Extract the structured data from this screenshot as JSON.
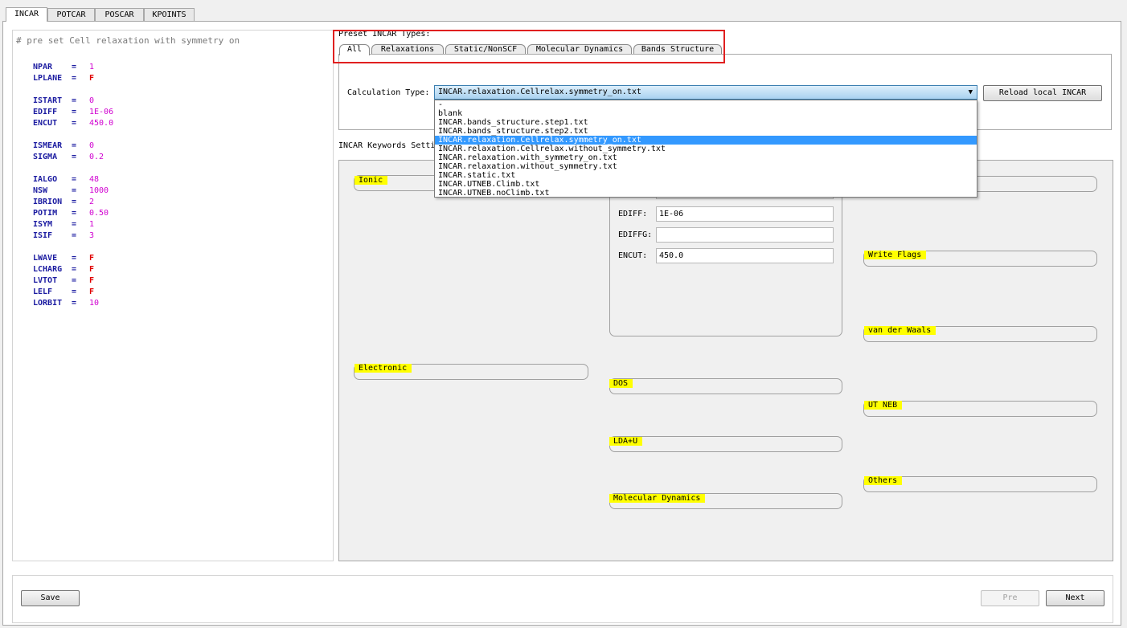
{
  "top_tabs": [
    "INCAR",
    "POTCAR",
    "POSCAR",
    "KPOINTS"
  ],
  "incar_text": {
    "comment": "# pre set Cell relaxation with symmetry on",
    "lines": [
      {
        "key": "NPAR",
        "value": "1",
        "flag": false
      },
      {
        "key": "LPLANE",
        "value": "F",
        "flag": true
      },
      {
        "key": "ISTART",
        "value": "0",
        "flag": false
      },
      {
        "key": "EDIFF",
        "value": "1E-06",
        "flag": false
      },
      {
        "key": "ENCUT",
        "value": "450.0",
        "flag": false
      },
      {
        "key": "ISMEAR",
        "value": "0",
        "flag": false
      },
      {
        "key": "SIGMA",
        "value": "0.2",
        "flag": false
      },
      {
        "key": "IALGO",
        "value": "48",
        "flag": false
      },
      {
        "key": "NSW",
        "value": "1000",
        "flag": false
      },
      {
        "key": "IBRION",
        "value": "2",
        "flag": false
      },
      {
        "key": "POTIM",
        "value": "0.50",
        "flag": false
      },
      {
        "key": "ISYM",
        "value": "1",
        "flag": false
      },
      {
        "key": "ISIF",
        "value": "3",
        "flag": false
      },
      {
        "key": "LWAVE",
        "value": "F",
        "flag": true
      },
      {
        "key": "LCHARG",
        "value": "F",
        "flag": true
      },
      {
        "key": "LVTOT",
        "value": "F",
        "flag": true
      },
      {
        "key": "LELF",
        "value": "F",
        "flag": true
      },
      {
        "key": "LORBIT",
        "value": "10",
        "flag": false
      }
    ]
  },
  "preset": {
    "label": "Preset INCAR Types:",
    "tabs": [
      "All",
      "Relaxations",
      "Static/NonSCF",
      "Molecular Dynamics",
      "Bands Structure"
    ],
    "calc_type_label": "Calculation Type:",
    "calc_type_value": "INCAR.relaxation.Cellrelax.symmetry_on.txt",
    "reload_button": "Reload local INCAR",
    "options": [
      "-",
      "blank",
      "INCAR.bands_structure.step1.txt",
      "INCAR.bands_structure.step2.txt",
      "INCAR.relaxation.Cellrelax.symmetry_on.txt",
      "INCAR.relaxation.Cellrelax.without_symmetry.txt",
      "INCAR.relaxation.with_symmetry_on.txt",
      "INCAR.relaxation.without_symmetry.txt",
      "INCAR.static.txt",
      "INCAR.UTNEB.Climb.txt",
      "INCAR.UTNEB.noClimb.txt"
    ],
    "selected_index": 4
  },
  "keywords": {
    "label": "INCAR Keywords Setti",
    "groups": {
      "ionic": "Ionic",
      "electronic": "Electronic",
      "dos": "DOS",
      "ldau": "LDA+U",
      "md": "Molecular Dynamics",
      "write_flags": "Write Flags",
      "vdw": "van der Waals",
      "utneb": "UT NEB",
      "others": "Others"
    },
    "fields": {
      "ediff_label": "EDIFF:",
      "ediff_value": "1E-06",
      "ediffg_label": "EDIFFG:",
      "ediffg_value": "",
      "encut_label": "ENCUT:",
      "encut_value": "450.0"
    }
  },
  "bottom": {
    "save": "Save",
    "pre": "Pre",
    "next": "Next"
  }
}
